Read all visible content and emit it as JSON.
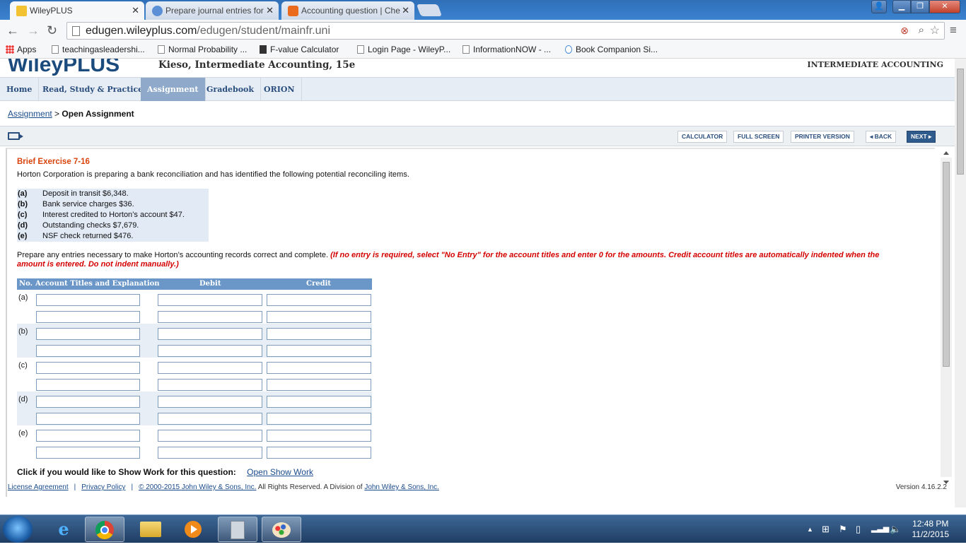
{
  "browser": {
    "tabs": [
      {
        "title": "WileyPLUS",
        "active": true
      },
      {
        "title": "Prepare journal entries for",
        "active": false
      },
      {
        "title": "Accounting question | Che",
        "active": false
      }
    ],
    "url_host": "edugen.wileyplus.com",
    "url_path": "/edugen/student/mainfr.uni",
    "bookmarks": [
      "Apps",
      "teachingasleadershi...",
      "Normal Probability ...",
      "F-value Calculator",
      "Login Page - WileyP...",
      "InformationNOW - ...",
      "Book Companion Si..."
    ]
  },
  "site": {
    "brand": "WileyPLUS",
    "book_title": "Kieso, Intermediate Accounting, 15e",
    "course": "INTERMEDIATE ACCOUNTING",
    "nav": [
      "Home",
      "Read, Study & Practice",
      "Assignment",
      "Gradebook",
      "ORION"
    ],
    "breadcrumb_link": "Assignment",
    "breadcrumb_sep": ">",
    "breadcrumb_current": "Open Assignment",
    "toolbar": {
      "calculator": "CALCULATOR",
      "full_screen": "FULL SCREEN",
      "printer": "PRINTER VERSION",
      "back": "◂ BACK",
      "next": "NEXT ▸"
    }
  },
  "exercise": {
    "title": "Brief Exercise 7-16",
    "intro": "Horton Corporation is preparing a bank reconciliation and has identified the following potential reconciling items.",
    "items": [
      {
        "label": "(a)",
        "text": "Deposit in transit $6,348."
      },
      {
        "label": "(b)",
        "text": "Bank service charges $36."
      },
      {
        "label": "(c)",
        "text": "Interest credited to Horton’s account $47."
      },
      {
        "label": "(d)",
        "text": "Outstanding checks $7,679."
      },
      {
        "label": "(e)",
        "text": "NSF check returned $476."
      }
    ],
    "instruction": "Prepare any entries necessary to make Horton’s accounting records correct and complete.",
    "instruction_note": "(If no entry is required, select \"No Entry\" for the account titles and enter 0 for the amounts. Credit account titles are automatically indented when the amount is entered. Do not indent manually.)",
    "table_headers": {
      "no": "No.",
      "account": "Account Titles and Explanation",
      "debit": "Debit",
      "credit": "Credit"
    },
    "rows": [
      "(a)",
      "(b)",
      "(c)",
      "(d)",
      "(e)"
    ],
    "show_work_label": "Click if you would like to Show Work for this question:",
    "show_work_link": "Open Show Work"
  },
  "footer": {
    "license": "License Agreement",
    "privacy": "Privacy Policy",
    "copyright": "© 2000-2015 John Wiley & Sons, Inc.",
    "rights": "All Rights Reserved. A Division of",
    "division": "John Wiley & Sons, Inc.",
    "version": "Version 4.16.2.2"
  },
  "taskbar": {
    "time": "12:48 PM",
    "date": "11/2/2015"
  }
}
